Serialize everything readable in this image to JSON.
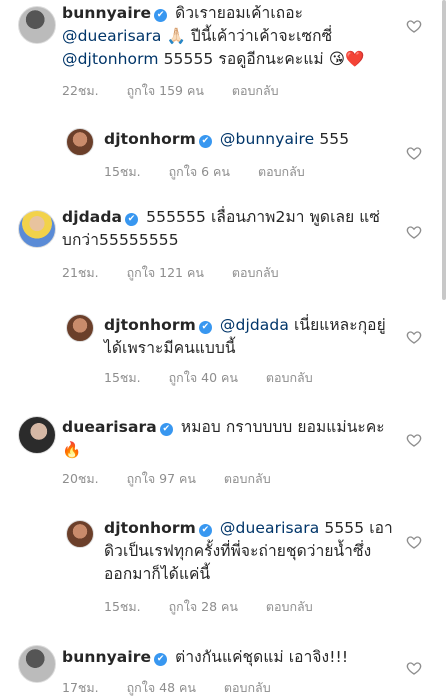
{
  "comments": [
    {
      "username": "bunnyaire",
      "text_a": "ดิวเรายอมเค้าเถอะ",
      "mention": "@duearisara",
      "text_b": "🙏🏻 ปีนี้เค้าว่าเค้าจะเซกซี่",
      "mention2": "@djtonhorm",
      "text_c": "55555 รอดูอีกนะคะแม่ 😘❤️",
      "time": "22ชม.",
      "likes": "ถูกใจ 159 คน",
      "reply": "ตอบกลับ"
    },
    {
      "username": "djtonhorm",
      "mention": "@bunnyaire",
      "text": "555",
      "time": "15ชม.",
      "likes": "ถูกใจ 6 คน",
      "reply": "ตอบกลับ"
    },
    {
      "username": "djdada",
      "text_a": "555555 เลื่อนภาพ2มา พูดเลย แซ่",
      "text_b": "บกว่า55555555",
      "time": "21ชม.",
      "likes": "ถูกใจ 121 คน",
      "reply": "ตอบกลับ"
    },
    {
      "username": "djtonhorm",
      "mention": "@djdada",
      "text_a": "เนี่ยแหละกุอยู่",
      "text_b": "ได้เพราะมีคนแบบนี้",
      "time": "15ชม.",
      "likes": "ถูกใจ 40 คน",
      "reply": "ตอบกลับ"
    },
    {
      "username": "duearisara",
      "text_a": "หมอบ กราบบบบ ยอมแม่นะคะ",
      "text_b": "🔥",
      "time": "20ชม.",
      "likes": "ถูกใจ 97 คน",
      "reply": "ตอบกลับ"
    },
    {
      "username": "djtonhorm",
      "mention": "@duearisara",
      "text_a": "5555 เอา",
      "text_b": "ดิวเป็นเรฟทุกครั้งที่พี่จะถ่ายชุดว่ายน้ำซึ่ง",
      "text_c": "ออกมาก็ได้แค่นี้",
      "time": "15ชม.",
      "likes": "ถูกใจ 28 คน",
      "reply": "ตอบกลับ"
    },
    {
      "username": "bunnyaire",
      "text": "ต่างกันแค่ชุดแม่ เอาจิง!!!",
      "time": "17ชม.",
      "likes": "ถูกใจ 48 คน",
      "reply": "ตอบกลับ"
    }
  ],
  "icons": {
    "verified": "✔",
    "heart": "heart-outline-icon"
  },
  "colors": {
    "verified": "#3897f0",
    "meta": "#8e8e8e",
    "text": "#262626"
  }
}
